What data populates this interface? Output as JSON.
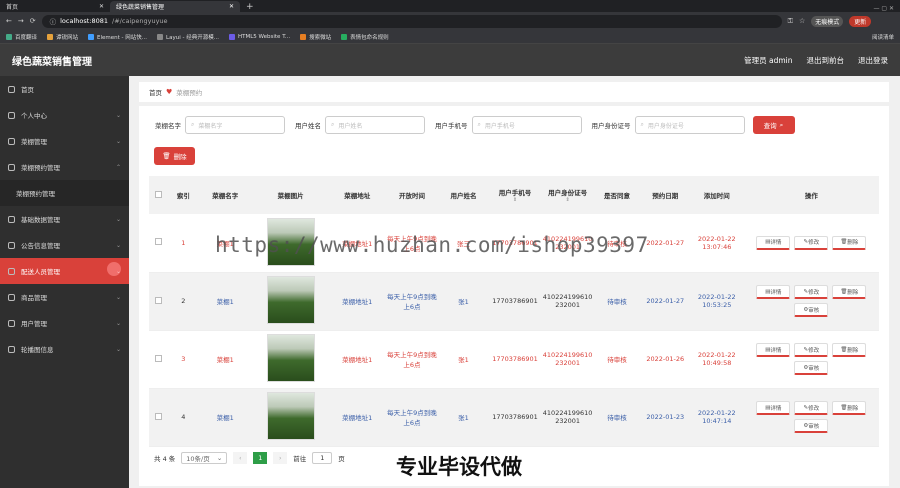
{
  "browser": {
    "tabs": [
      {
        "title": "首页",
        "active": false
      },
      {
        "title": "绿色蔬菜销售管理",
        "active": true
      }
    ],
    "url_host": "localhost:8081",
    "url_path": "/#/caipengyuyue",
    "incognito_label": "无痕模式",
    "update_label": "更新",
    "bookmarks": [
      "百度翻译",
      "谭锐网站",
      "Element - 网站快...",
      "Layui - 经典开源模...",
      "HTML5 Website T...",
      "搜索微站",
      "表情包命名规则"
    ],
    "reading_list": "阅读清单"
  },
  "app": {
    "title": "绿色蔬菜销售管理",
    "header_links": [
      "管理员 admin",
      "退出到前台",
      "退出登录"
    ]
  },
  "sidebar": {
    "items": [
      {
        "label": "首页",
        "icon": "home-icon",
        "chev": false
      },
      {
        "label": "个人中心",
        "icon": "user-icon",
        "chev": true
      },
      {
        "label": "菜棚管理",
        "icon": "grid-icon",
        "chev": true
      },
      {
        "label": "菜棚预约管理",
        "icon": "grid-icon",
        "chev": true
      },
      {
        "label": "菜棚预约管理",
        "icon": "",
        "chev": false,
        "sub": true
      },
      {
        "label": "基础数据管理",
        "icon": "grid-icon",
        "chev": true
      },
      {
        "label": "公告信息管理",
        "icon": "info-icon",
        "chev": true
      },
      {
        "label": "配送人员管理",
        "icon": "grid-icon",
        "chev": true,
        "active": true
      },
      {
        "label": "商品管理",
        "icon": "grid-icon",
        "chev": true
      },
      {
        "label": "用户管理",
        "icon": "user-icon",
        "chev": true
      },
      {
        "label": "轮播图信息",
        "icon": "grid-icon",
        "chev": true
      }
    ]
  },
  "breadcrumb": {
    "home": "首页",
    "current": "菜棚预约"
  },
  "search": {
    "fields": [
      {
        "label": "菜棚名字",
        "placeholder": "菜棚名字"
      },
      {
        "label": "用户姓名",
        "placeholder": "用户姓名"
      },
      {
        "label": "用户手机号",
        "placeholder": "用户手机号"
      },
      {
        "label": "用户身份证号",
        "placeholder": "用户身份证号"
      }
    ],
    "button": "查询"
  },
  "delete_button": "删除",
  "table": {
    "headers": [
      "索引",
      "菜棚名字",
      "菜棚图片",
      "菜棚地址",
      "开放时间",
      "用户姓名",
      "用户手机号",
      "用户身份证号",
      "是否同意",
      "预约日期",
      "添加时间",
      "操作"
    ],
    "rows": [
      {
        "index": "1",
        "name": "菜棚1",
        "address": "菜棚地址1",
        "open": "每天上午9点到晚上6点",
        "user": "张三",
        "phone": "17703786901",
        "id": "410224199610232001",
        "agree": "待审核",
        "date": "2022-01-27",
        "added": "2022-01-22 13:07:46",
        "style": "red"
      },
      {
        "index": "2",
        "name": "菜棚1",
        "address": "菜棚地址1",
        "open": "每天上午9点到晚上6点",
        "user": "张1",
        "phone": "17703786901",
        "id": "410224199610232001",
        "agree": "待审核",
        "date": "2022-01-27",
        "added": "2022-01-22 10:53:25",
        "style": "blue"
      },
      {
        "index": "3",
        "name": "菜棚1",
        "address": "菜棚地址1",
        "open": "每天上午9点到晚上6点",
        "user": "张1",
        "phone": "17703786901",
        "id": "410224199610232001",
        "agree": "待审核",
        "date": "2022-01-26",
        "added": "2022-01-22 10:49:58",
        "style": "red"
      },
      {
        "index": "4",
        "name": "菜棚1",
        "address": "菜棚地址1",
        "open": "每天上午9点到晚上6点",
        "user": "张1",
        "phone": "17703786901",
        "id": "410224199610232001",
        "agree": "待审核",
        "date": "2022-01-23",
        "added": "2022-01-22 10:47:14",
        "style": "blue"
      }
    ],
    "ops": {
      "detail": "详情",
      "edit": "修改",
      "delete": "删除",
      "audit": "审核"
    }
  },
  "pager": {
    "total": "共 4 条",
    "size": "10条/页",
    "page": "1",
    "goto": "前往",
    "goto_value": "1",
    "unit": "页"
  },
  "watermark": "https://www.huzhan.com/ishop39397",
  "footer_caption": "专业毕设代做"
}
